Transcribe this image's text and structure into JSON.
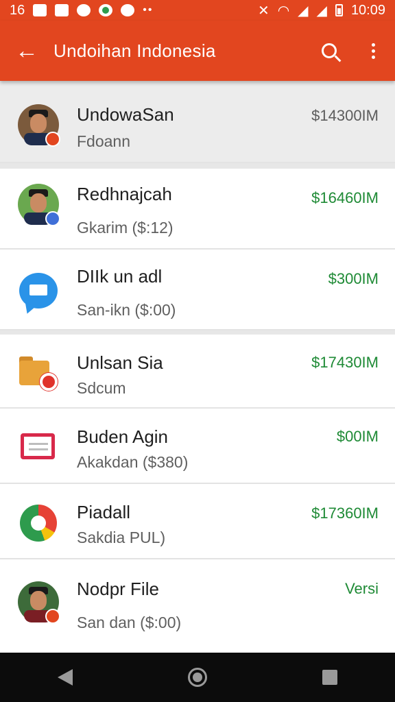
{
  "status_bar": {
    "left_time": "16",
    "right_time": "10:09"
  },
  "app_bar": {
    "title": "Undoihan Indonesia"
  },
  "list": [
    {
      "title": "UndowaSan",
      "subtitle": "Fdoann",
      "value": "$14300IM",
      "icon": "person-avatar"
    },
    {
      "title": "Redhnajcah",
      "subtitle": "Gkarim ($:12)",
      "value": "$16460IM",
      "icon": "person-avatar"
    },
    {
      "title": "DIIk un adl",
      "subtitle": "San-ikn ($:00)",
      "value": "$300IM",
      "icon": "message-icon"
    },
    {
      "title": "Unlsan Sia",
      "subtitle": "Sdcum",
      "value": "$17430IM",
      "icon": "folder-settings-icon"
    },
    {
      "title": "Buden Agin",
      "subtitle": "Akakdan ($380)",
      "value": "$00IM",
      "icon": "calendar-icon"
    },
    {
      "title": "Piadall",
      "subtitle": "Sakdia PUL)",
      "value": "$17360IM",
      "icon": "chrome-icon"
    },
    {
      "title": "Nodpr File",
      "subtitle": "San dan ($:00)",
      "value": "Versi",
      "icon": "person-avatar"
    }
  ],
  "colors": {
    "accent": "#e2461f",
    "value_green": "#1e8a35"
  }
}
